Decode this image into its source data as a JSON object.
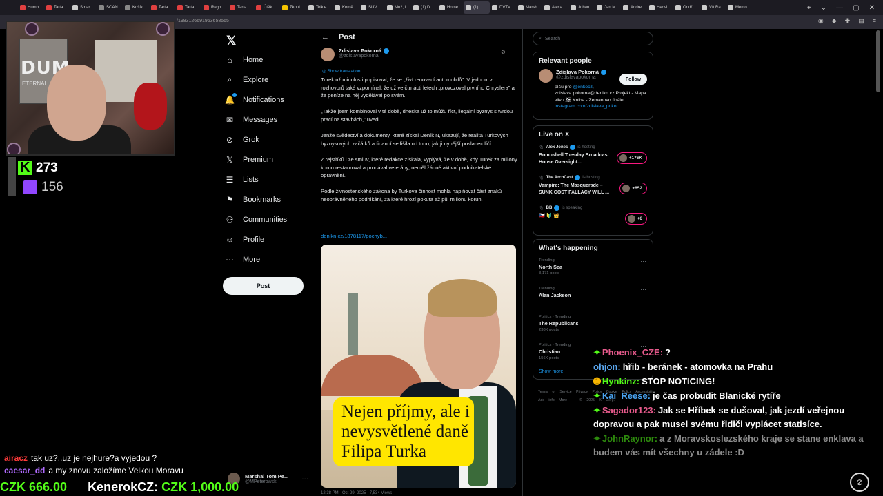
{
  "browser": {
    "tabs": [
      {
        "label": "Humb",
        "color": "#e04040"
      },
      {
        "label": "Tarta",
        "color": "#e04040"
      },
      {
        "label": "Smar",
        "color": "#cccccc"
      },
      {
        "label": "SCAN",
        "color": "#888888"
      },
      {
        "label": "Košík",
        "color": "#888888"
      },
      {
        "label": "Tarta",
        "color": "#e04040"
      },
      {
        "label": "Tarta",
        "color": "#e04040"
      },
      {
        "label": "Regn",
        "color": "#e04040"
      },
      {
        "label": "Tarta",
        "color": "#e04040"
      },
      {
        "label": "Útěk",
        "color": "#e04040"
      },
      {
        "label": "Zkoul",
        "color": "#f5c400"
      },
      {
        "label": "Tolkie",
        "color": "#cccccc"
      },
      {
        "label": "Komě",
        "color": "#cccccc"
      },
      {
        "label": "SUV",
        "color": "#cccccc"
      },
      {
        "label": "Muž, l",
        "color": "#cccccc"
      },
      {
        "label": "(1) D",
        "color": "#cccccc"
      },
      {
        "label": "Home",
        "color": "#cccccc"
      },
      {
        "label": "(1)",
        "color": "#cccccc"
      },
      {
        "label": "DVTV",
        "color": "#cccccc"
      },
      {
        "label": "Marsh",
        "color": "#cccccc"
      },
      {
        "label": "Alexa",
        "color": "#cccccc"
      },
      {
        "label": "Johan",
        "color": "#cccccc"
      },
      {
        "label": "Jan M",
        "color": "#cccccc"
      },
      {
        "label": "Andre",
        "color": "#cccccc"
      },
      {
        "label": "Hedvi",
        "color": "#cccccc"
      },
      {
        "label": "Ondř",
        "color": "#cccccc"
      },
      {
        "label": "Vít Ra",
        "color": "#cccccc"
      },
      {
        "label": "Memo",
        "color": "#cccccc"
      }
    ],
    "url": "/1983126691963658565"
  },
  "overlay": {
    "webcam_logo": "DUM",
    "webcam_logo_sub": "ETERNAL",
    "kick_viewers": "273",
    "twitch_viewers": "156"
  },
  "nav": {
    "items": [
      "Home",
      "Explore",
      "Notifications",
      "Messages",
      "Grok",
      "Premium",
      "Lists",
      "Bookmarks",
      "Communities",
      "Profile",
      "More"
    ],
    "post_button": "Post",
    "account_name": "Marshal Tom Pe...",
    "account_handle": "@MPeterowski"
  },
  "post": {
    "header": "Post",
    "author_name": "Zdislava Pokorná",
    "author_handle": "@zdislavapokorna",
    "show_translation": "Show translation",
    "paragraphs": [
      "Turek už minulosti popisoval, že se „živí renovací automobilů\". V jednom z rozhovorů také vzpomínal, že už ve čtrnácti letech „provozoval prvního Chryslera\" a že peníze na něj vydělával po svém.",
      "„Takže jsem kombinoval v té době, dneska už to můžu říct, ilegální byznys s tvrdou prací na stavbách,\" uvedl.",
      "Jenže svědectví a dokumenty, které získal Deník N, ukazují, že realita Turkových byznysových začátků a financí se lišila od toho, jak ji nynější poslanec líčí.",
      "Z rejstříků i ze smluv, které redakce získala, vyplývá, že v době, kdy Turek za miliony korun restauroval a prodával veterány, neměl žádné aktivní podnikatelské oprávnění.",
      "Podle živnostenského zákona by Turkova činnost mohla naplňovat část znaků neoprávněného podnikání, za které hrozí pokuta až půl milionu korun."
    ],
    "link": "denikn.cz/1878117/pochyb...",
    "image_caption": "Nejen příjmy, ale i nevysvětlené daně Filipa Turka",
    "footer": "12:38 PM · Oct 29, 2025 · 7,534 Views"
  },
  "sidebar": {
    "search_placeholder": "Search",
    "relevant_title": "Relevant people",
    "rp_name": "Zdislava Pokorná",
    "rp_handle": "@zdislavapokorna",
    "follow_label": "Follow",
    "rp_bio_prefix": "píšu pro ",
    "rp_bio_mention": "@enkocz",
    "rp_bio_rest": ", zdislava.pokorna@denikn.cz Projekt - Mapa vlivu 🗺 Kniha - Zemanovo finále",
    "rp_bio_link": "instagram.com/zdislava_pokor...",
    "live_title": "Live on X",
    "live": [
      {
        "host": "Alex Jones",
        "status": "is hosting",
        "title": "Bombshell Tuesday Broadcast: House Oversight...",
        "count": "+176K"
      },
      {
        "host": "The ArchCast",
        "status": "is hosting",
        "title": "Vampire: The Masquerade – SUNK COST FALLACY WILL ...",
        "count": "+652"
      },
      {
        "host": "BB",
        "status": "is speaking",
        "title": "🇨🇿 🔰 👑",
        "count": "+6"
      }
    ],
    "happening_title": "What's happening",
    "trends": [
      {
        "meta": "Trending",
        "name": "North Sea",
        "posts": "3,171 posts"
      },
      {
        "meta": "Trending",
        "name": "Alan Jackson",
        "posts": ""
      },
      {
        "meta": "Politics · Trending",
        "name": "The Republicans",
        "posts": "238K posts"
      },
      {
        "meta": "Politics · Trending",
        "name": "Christian",
        "posts": "156K posts"
      }
    ],
    "show_more": "Show more",
    "footer_links": "Terms of Service  Privacy Policy  Cookie Policy  Accessibility  Ads info  More ···  © 2025 X Corp."
  },
  "chat": {
    "right": [
      {
        "user": "Phoenix_CZE:",
        "color": "#e75a8c",
        "badge": "✦",
        "badge_class": "badge-green",
        "msg": "?",
        "faded": false
      },
      {
        "user": "ohjon:",
        "color": "#5aa7f0",
        "badge": "",
        "badge_class": "",
        "msg": "hřib - beránek - atomovka na Prahu",
        "faded": false
      },
      {
        "user": "Hynkinz:",
        "color": "#53fc18",
        "badge": "➊",
        "badge_class": "badge-yellow",
        "msg": "STOP NOTICING!",
        "faded": false
      },
      {
        "user": "Kai_Reese:",
        "color": "#4aa3f0",
        "badge": "✦",
        "badge_class": "badge-green",
        "msg": "je čas probudit Blanické rytíře",
        "faded": false
      },
      {
        "user": "Sagador123:",
        "color": "#e75a8c",
        "badge": "✦",
        "badge_class": "badge-green",
        "msg": "Jak se Hříbek se dušoval, jak jezdí veřejnou dopravou a pak musel svému řidiči vyplácet statisíce.",
        "faded": false
      },
      {
        "user": "JohnRaynor:",
        "color": "#53fc18",
        "badge": "✦",
        "badge_class": "badge-green",
        "msg": "a z Moravskoslezského kraje se stane enklava a budem vás mít všechny u zádele :D",
        "faded": true
      }
    ],
    "left": [
      {
        "user": "airacz",
        "color": "#ff3b3b",
        "msg": "tak uz?..uz je nejhure?a vyjedou ?"
      },
      {
        "user": "caesar_dd",
        "color": "#b06bff",
        "msg": "a my znovu založíme Velkou Moravu"
      }
    ],
    "tips": [
      {
        "user": "",
        "amount": "CZK 666.00"
      },
      {
        "user": "KenerokCZ:",
        "amount": "CZK 1,000.00"
      }
    ]
  },
  "colors": {
    "accent": "#1d9bf0",
    "kick": "#53fc18",
    "twitch": "#9146ff",
    "live": "#f91880"
  }
}
